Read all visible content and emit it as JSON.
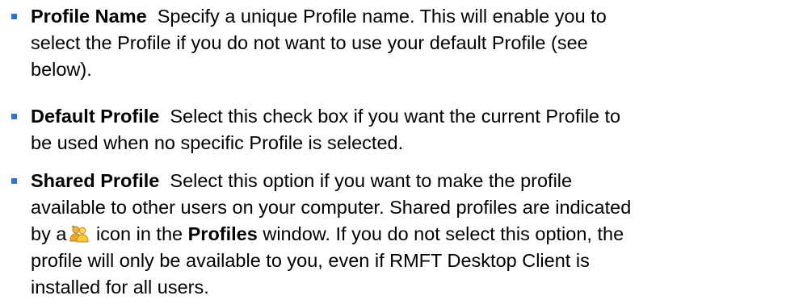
{
  "items": [
    {
      "term": "Profile Name",
      "lines": [
        "Specify a unique Profile name. This will enable you to",
        "select the Profile if you do not want to use your default Profile (see",
        "below)."
      ]
    },
    {
      "term": "Default Profile",
      "lines": [
        "Select this check box if you want the current Profile to",
        "be used when no specific Profile is selected."
      ]
    },
    {
      "term": "Shared Profile",
      "lines": [
        "Select this option if you want to make the profile",
        "available to other users on your computer. Shared profiles are indicated"
      ],
      "line3": {
        "before_icon": "by a",
        "after_icon": "icon in the",
        "bold_word": "Profiles",
        "after_bold": "window. If you do not select this option, the"
      },
      "lines_after": [
        "profile will only be available to you, even if RMFT Desktop Client is",
        "installed for all users."
      ],
      "icon": "shared-users-icon"
    }
  ],
  "colors": {
    "bullet": "#2f73d6",
    "text": "#000000"
  }
}
